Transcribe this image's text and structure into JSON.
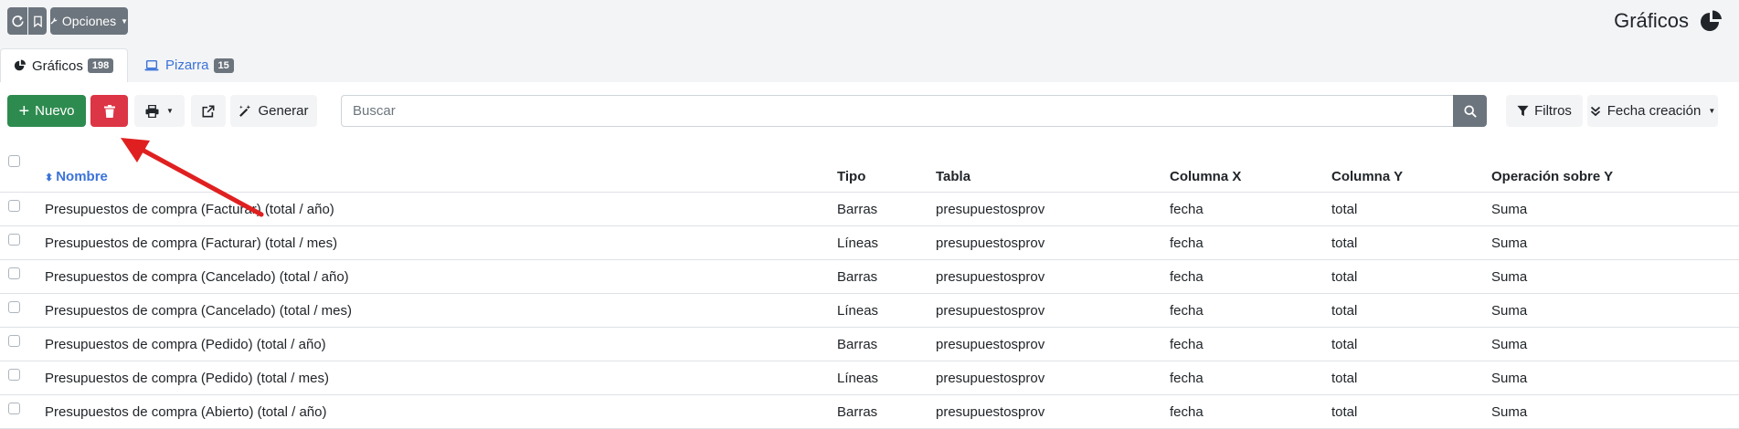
{
  "header": {
    "title": "Gráficos",
    "options_label": "Opciones"
  },
  "tabs": [
    {
      "label": "Gráficos",
      "count": "198",
      "active": true
    },
    {
      "label": "Pizarra",
      "count": "15",
      "active": false
    }
  ],
  "toolbar": {
    "new_label": "Nuevo",
    "generate_label": "Generar",
    "filters_label": "Filtros",
    "sort_label": "Fecha creación",
    "search_placeholder": "Buscar"
  },
  "table": {
    "columns": [
      "Nombre",
      "Tipo",
      "Tabla",
      "Columna X",
      "Columna Y",
      "Operación sobre Y"
    ],
    "rows": [
      [
        "Presupuestos de compra (Facturar) (total / año)",
        "Barras",
        "presupuestosprov",
        "fecha",
        "total",
        "Suma"
      ],
      [
        "Presupuestos de compra (Facturar) (total / mes)",
        "Líneas",
        "presupuestosprov",
        "fecha",
        "total",
        "Suma"
      ],
      [
        "Presupuestos de compra (Cancelado) (total / año)",
        "Barras",
        "presupuestosprov",
        "fecha",
        "total",
        "Suma"
      ],
      [
        "Presupuestos de compra (Cancelado) (total / mes)",
        "Líneas",
        "presupuestosprov",
        "fecha",
        "total",
        "Suma"
      ],
      [
        "Presupuestos de compra (Pedido) (total / año)",
        "Barras",
        "presupuestosprov",
        "fecha",
        "total",
        "Suma"
      ],
      [
        "Presupuestos de compra (Pedido) (total / mes)",
        "Líneas",
        "presupuestosprov",
        "fecha",
        "total",
        "Suma"
      ],
      [
        "Presupuestos de compra (Abierto) (total / año)",
        "Barras",
        "presupuestosprov",
        "fecha",
        "total",
        "Suma"
      ]
    ]
  },
  "colors": {
    "success": "#2e8b4f",
    "danger": "#dc3545",
    "secondary": "#6c757d",
    "link": "#3b73d9",
    "annotation_arrow": "#e02020"
  }
}
